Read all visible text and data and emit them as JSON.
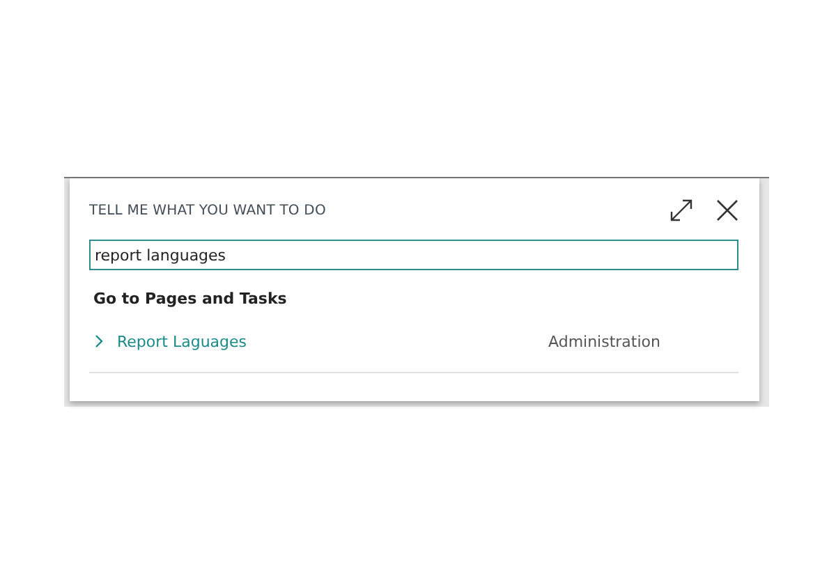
{
  "dialog": {
    "title": "TELL ME WHAT YOU WANT TO DO",
    "search": {
      "value": "report languages"
    },
    "section": "Go to Pages and Tasks",
    "results": [
      {
        "label": "Report Laguages",
        "category": "Administration"
      }
    ]
  }
}
